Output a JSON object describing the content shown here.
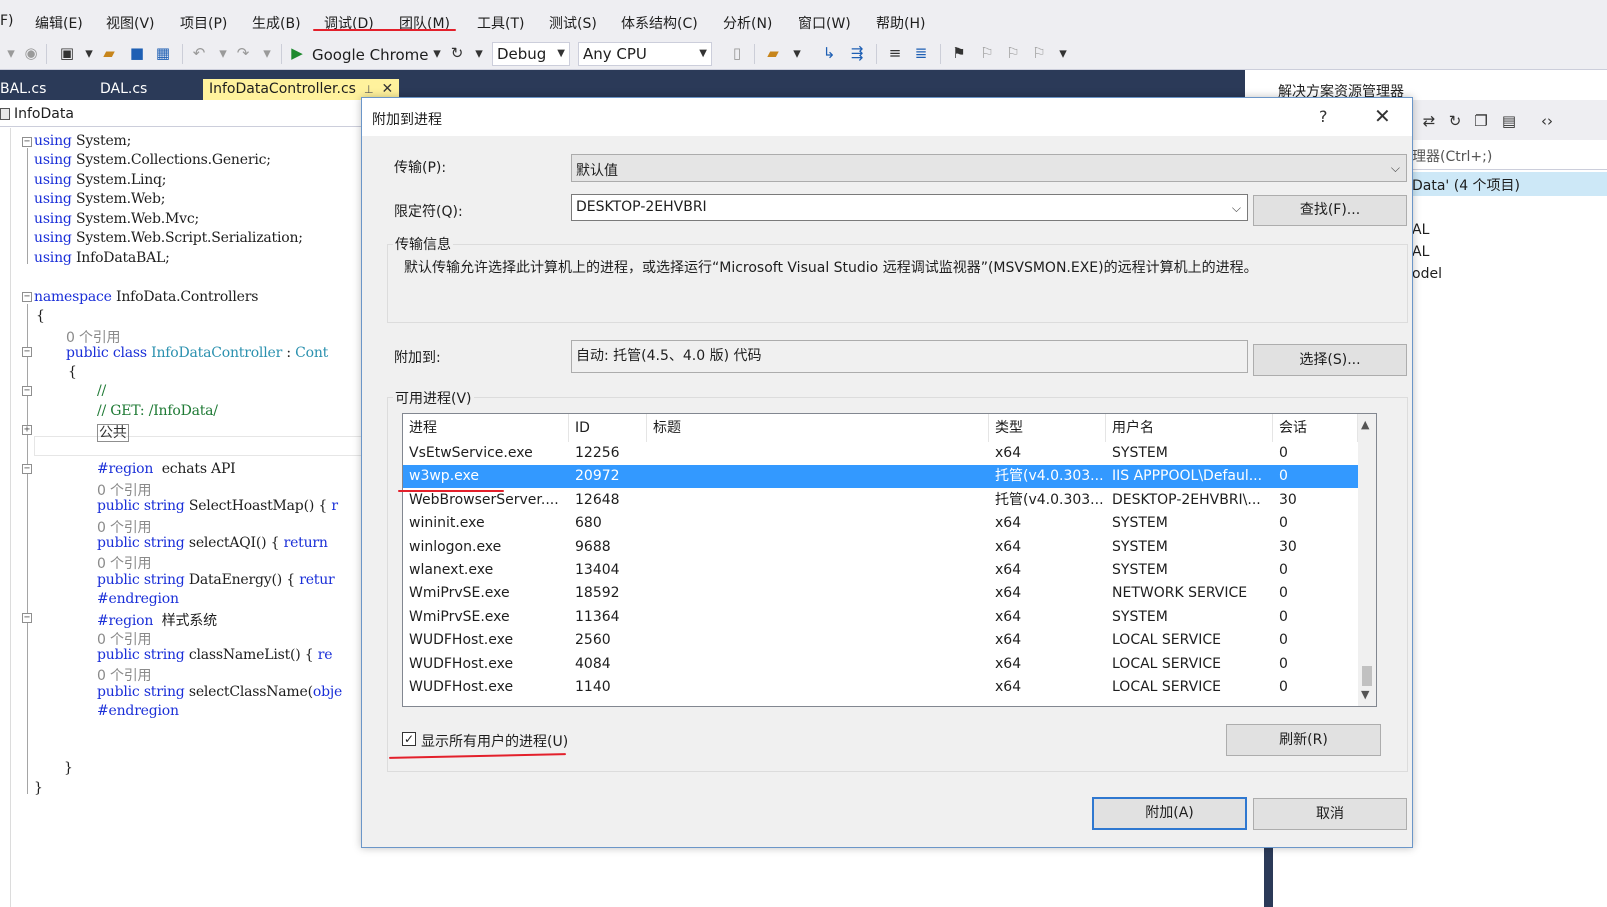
{
  "menu": [
    "F)",
    "编辑(E)",
    "视图(V)",
    "项目(P)",
    "生成(B)",
    "调试(D)",
    "团队(M)",
    "工具(T)",
    "测试(S)",
    "体系结构(C)",
    "分析(N)",
    "窗口(W)",
    "帮助(H)"
  ],
  "toolbar": {
    "browser": "Google Chrome",
    "config": "Debug",
    "platform": "Any CPU"
  },
  "tabs": [
    "BAL.cs",
    "DAL.cs",
    "InfoDataController.cs"
  ],
  "editor": {
    "nav_text": "InfoData",
    "lines": {
      "u1": "System;",
      "u2": "System.Collections.Generic;",
      "u3": "System.Linq;",
      "u4": "System.Web;",
      "u5": "System.Web.Mvc;",
      "u6": "System.Web.Script.Serialization;",
      "u7": "InfoDataBAL;",
      "kw_using": "using",
      "kw_namespace": "namespace",
      "ns_name": " InfoData.Controllers",
      "brace_open": "{",
      "brace_close": "}",
      "refs": "0 个引用",
      "kw_public": "public",
      "kw_class": "class",
      "kw_string": "string",
      "kw_return": "return",
      "class_name": "InfoDataController",
      "class_rest": " : ",
      "base_name": "Cont",
      "comment1": "//",
      "comment2": "// GET: /InfoData/",
      "collapsed": "公共",
      "region_kw": "#region",
      "region1": "  echats API",
      "region2": "  样式系统",
      "endregion": "#endregion",
      "m1": " SelectHoastMap() { ",
      "m1r": "r",
      "m2": " selectAQI() { ",
      "m2r": "return",
      "m3": " DataEnergy() { ",
      "m3r": "retur",
      "m4": " classNameList() { ",
      "m4r": "re",
      "m5": " selectClassName(",
      "m5r": "obje"
    }
  },
  "solution": {
    "title": "解决方案资源管理器",
    "search": "理器(Ctrl+;)",
    "selected": "Data' (4 个项目)",
    "items": [
      "AL",
      "AL",
      "odel"
    ]
  },
  "dialog": {
    "title": "附加到进程",
    "help": "?",
    "transport_label": "传输(P):",
    "transport_value": "默认值",
    "qualifier_label": "限定符(Q):",
    "qualifier_value": "DESKTOP-2EHVBRI",
    "find_button": "查找(F)...",
    "transport_info_title": "传输信息",
    "transport_info_text": "默认传输允许选择此计算机上的进程，或选择运行“Microsoft Visual Studio 远程调试监视器”(MSVSMON.EXE)的远程计算机上的进程。",
    "attach_to_label": "附加到:",
    "attach_to_value": "自动: 托管(4.5、4.0 版) 代码",
    "select_button": "选择(S)...",
    "available_title": "可用进程(V)",
    "columns": [
      "进程",
      "ID",
      "标题",
      "类型",
      "用户名",
      "会话"
    ],
    "processes": [
      {
        "name": "VsEtwService.exe",
        "id": "12256",
        "title": "",
        "type": "x64",
        "user": "SYSTEM",
        "session": "0"
      },
      {
        "name": "w3wp.exe",
        "id": "20972",
        "title": "",
        "type": "托管(v4.0.303...",
        "user": "IIS APPPOOL\\Defaul...",
        "session": "0"
      },
      {
        "name": "WebBrowserServer....",
        "id": "12648",
        "title": "",
        "type": "托管(v4.0.303...",
        "user": "DESKTOP-2EHVBRI\\...",
        "session": "30"
      },
      {
        "name": "wininit.exe",
        "id": "680",
        "title": "",
        "type": "x64",
        "user": "SYSTEM",
        "session": "0"
      },
      {
        "name": "winlogon.exe",
        "id": "9688",
        "title": "",
        "type": "x64",
        "user": "SYSTEM",
        "session": "30"
      },
      {
        "name": "wlanext.exe",
        "id": "13404",
        "title": "",
        "type": "x64",
        "user": "SYSTEM",
        "session": "0"
      },
      {
        "name": "WmiPrvSE.exe",
        "id": "18592",
        "title": "",
        "type": "x64",
        "user": "NETWORK SERVICE",
        "session": "0"
      },
      {
        "name": "WmiPrvSE.exe",
        "id": "11364",
        "title": "",
        "type": "x64",
        "user": "SYSTEM",
        "session": "0"
      },
      {
        "name": "WUDFHost.exe",
        "id": "2560",
        "title": "",
        "type": "x64",
        "user": "LOCAL SERVICE",
        "session": "0"
      },
      {
        "name": "WUDFHost.exe",
        "id": "4084",
        "title": "",
        "type": "x64",
        "user": "LOCAL SERVICE",
        "session": "0"
      },
      {
        "name": "WUDFHost.exe",
        "id": "1140",
        "title": "",
        "type": "x64",
        "user": "LOCAL SERVICE",
        "session": "0"
      }
    ],
    "selected_process": "w3wp.exe",
    "show_all_users_label": "显示所有用户的进程(U)",
    "show_all_users_checked": true,
    "check_mark": "✓",
    "refresh_button": "刷新(R)",
    "attach_button": "附加(A)",
    "cancel_button": "取消"
  },
  "colors": {
    "menubar": "#eeeef2",
    "tab_band": "#2b3a58",
    "active_tab": "#fff29d",
    "selection": "#3399ff",
    "annotation_red": "#e3202b",
    "keyword": "#1a2fd8",
    "type": "#2b91af",
    "comment": "#1f7a35"
  }
}
